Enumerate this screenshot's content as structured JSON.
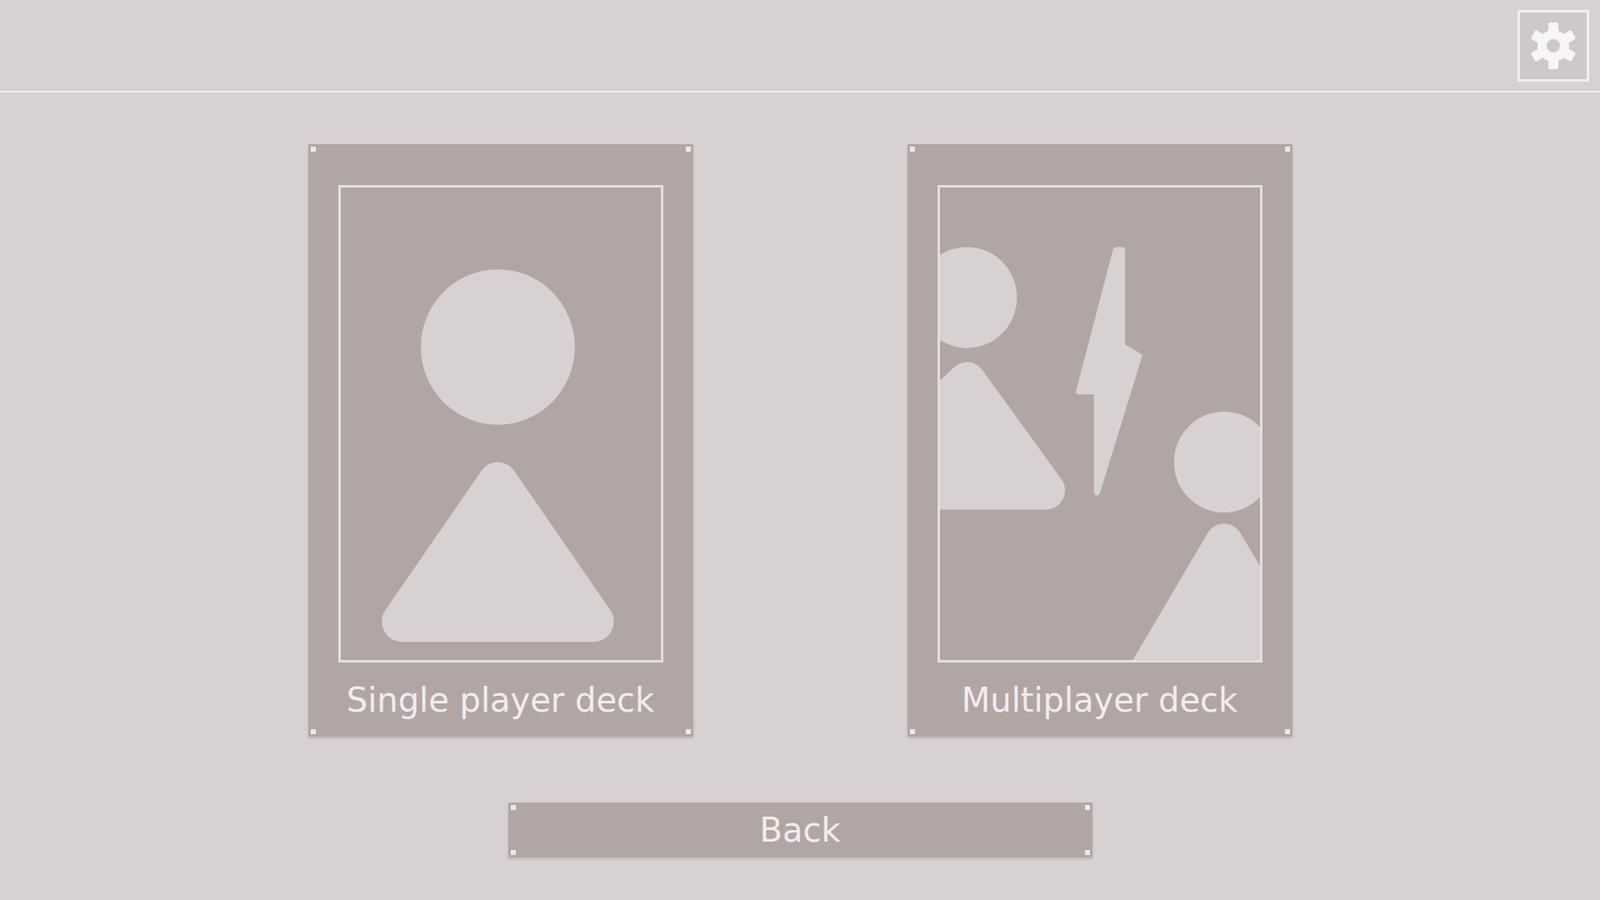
{
  "decks": [
    {
      "label": "Single player deck",
      "kind": "single"
    },
    {
      "label": "Multiplayer deck",
      "kind": "multi"
    }
  ],
  "buttons": [
    "Back"
  ]
}
